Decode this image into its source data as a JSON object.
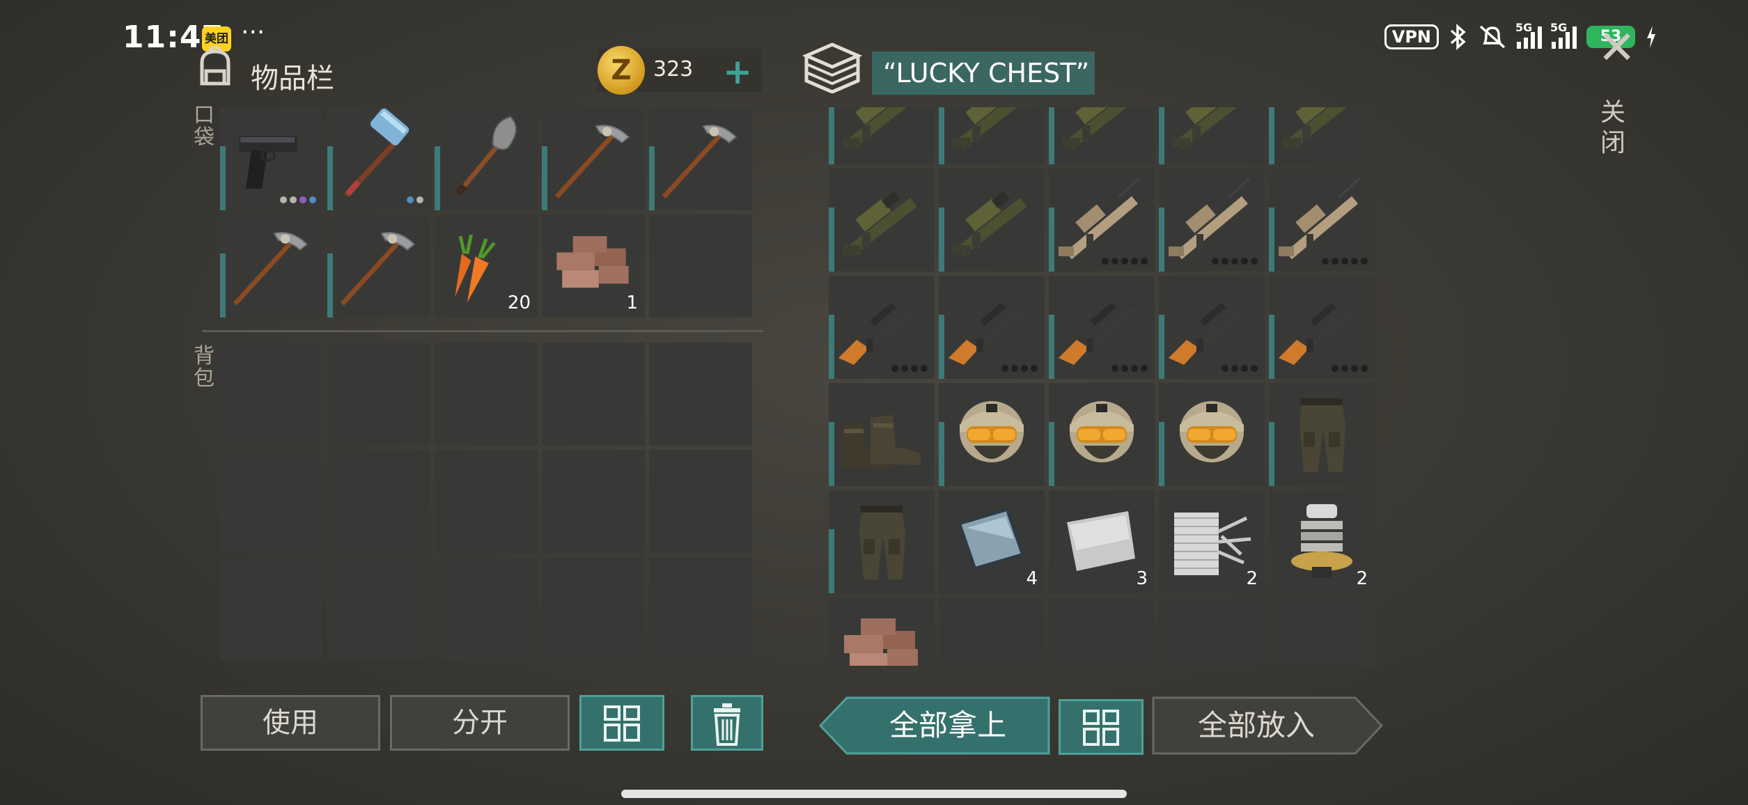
{
  "status_bar": {
    "time": "11:47",
    "app_badge": "美团",
    "more": "···",
    "vpn": "VPN",
    "network_1": "5G",
    "network_2": "5G",
    "battery": "53"
  },
  "inventory": {
    "title": "物品栏",
    "coins": "323",
    "coin_symbol": "Z",
    "add_coins": "+",
    "pocket_label": "口袋",
    "backpack_label": "背包",
    "pocket_slots": [
      {
        "item": "pistol",
        "dots": [
          "grey",
          "grey",
          "purple",
          "blue"
        ]
      },
      {
        "item": "sledgehammer",
        "dots": [
          "blue",
          "grey"
        ]
      },
      {
        "item": "shovel"
      },
      {
        "item": "pickaxe"
      },
      {
        "item": "pickaxe"
      },
      {
        "item": "pickaxe"
      },
      {
        "item": "pickaxe"
      },
      {
        "item": "carrots",
        "qty": "20"
      },
      {
        "item": "bricks",
        "qty": "1"
      },
      {
        "item": ""
      }
    ],
    "backpack_slots": 15
  },
  "chest": {
    "name": "“LUCKY CHEST”",
    "slots": [
      {
        "item": "grenade-launcher-rifle"
      },
      {
        "item": "grenade-launcher-rifle"
      },
      {
        "item": "grenade-launcher-rifle"
      },
      {
        "item": "grenade-launcher-rifle"
      },
      {
        "item": "grenade-launcher-rifle"
      },
      {
        "item": "grenade-launcher-rifle"
      },
      {
        "item": "grenade-launcher-rifle"
      },
      {
        "item": "tan-assault-rifle"
      },
      {
        "item": "tan-assault-rifle"
      },
      {
        "item": "tan-assault-rifle"
      },
      {
        "item": "sniper-rifle"
      },
      {
        "item": "sniper-rifle"
      },
      {
        "item": "sniper-rifle"
      },
      {
        "item": "sniper-rifle"
      },
      {
        "item": "sniper-rifle"
      },
      {
        "item": "military-boots"
      },
      {
        "item": "military-helmet"
      },
      {
        "item": "military-helmet"
      },
      {
        "item": "military-helmet"
      },
      {
        "item": "military-pants"
      },
      {
        "item": "military-pants"
      },
      {
        "item": "glass-plate",
        "qty": "4"
      },
      {
        "item": "steel-plate",
        "qty": "3"
      },
      {
        "item": "mesh-fiber",
        "qty": "2"
      },
      {
        "item": "spring-part",
        "qty": "2"
      },
      {
        "item": "bricks"
      },
      {
        "item": ""
      },
      {
        "item": ""
      },
      {
        "item": ""
      },
      {
        "item": ""
      }
    ]
  },
  "buttons": {
    "use": "使用",
    "split": "分开",
    "take_all": "全部拿上",
    "put_all": "全部放入"
  },
  "close": {
    "label": "关闭"
  },
  "colors": {
    "accent": "#35716c",
    "accent_border": "#4fa19a",
    "slot": "#383937",
    "bar": "#3d7b78"
  }
}
